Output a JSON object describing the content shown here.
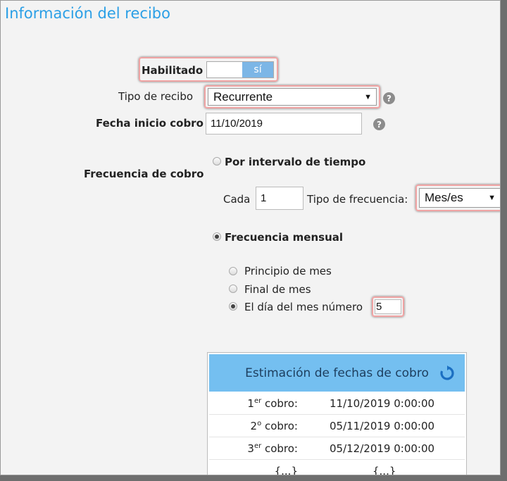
{
  "header": {
    "title": "Información del recibo"
  },
  "form": {
    "habilitado": {
      "label": "Habilitado",
      "toggle_on": "sí"
    },
    "tipo_recibo": {
      "label": "Tipo de recibo",
      "value": "Recurrente"
    },
    "fecha_inicio": {
      "label": "Fecha inicio cobro",
      "value": "11/10/2019"
    },
    "help_glyph": "?",
    "frecuencia": {
      "label": "Frecuencia de cobro",
      "option_intervalo": "Por intervalo de tiempo",
      "cada_label": "Cada",
      "cada_value": "1",
      "tipo_frecuencia_label": "Tipo de frecuencia:",
      "tipo_frecuencia_value": "Mes/es",
      "option_mensual": "Frecuencia mensual",
      "mensual_options": [
        "Principio de mes",
        "Final de mes",
        "El día del mes número"
      ],
      "dia_value": "5"
    }
  },
  "estimacion": {
    "title": "Estimación de fechas de cobro",
    "rows": [
      {
        "n": "1",
        "suffix": "er",
        "word": " cobro:",
        "date": "11/10/2019 0:00:00"
      },
      {
        "n": "2",
        "suffix": "o",
        "word": " cobro:",
        "date": "05/11/2019 0:00:00"
      },
      {
        "n": "3",
        "suffix": "er",
        "word": " cobro:",
        "date": "05/12/2019 0:00:00"
      },
      {
        "k": "{...}",
        "date": "{...}"
      }
    ]
  },
  "colors": {
    "title": "#2b9fe6",
    "accent": "#74bff0",
    "highlight": "#f0a4a4"
  },
  "icons": [
    "help-icon",
    "chevron-down-icon",
    "refresh-icon"
  ]
}
